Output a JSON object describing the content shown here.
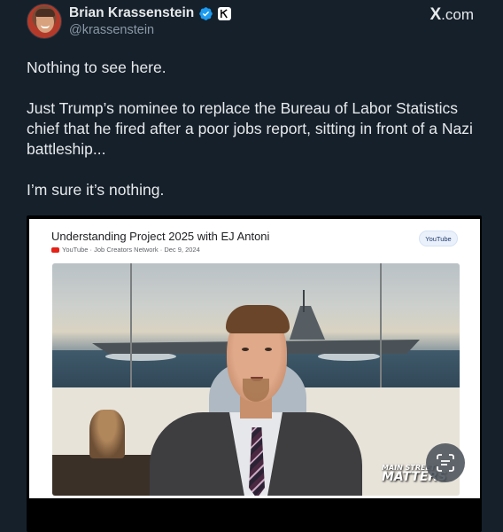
{
  "author": {
    "display_name": "Brian Krassenstein",
    "handle": "@krassenstein",
    "avatar_icon": "avatar-photo",
    "verified_icon": "verified-badge-icon",
    "affiliation_icon": "k-affiliate-icon"
  },
  "site": {
    "x": "X",
    "rest": ".com"
  },
  "tweet": {
    "paragraphs": [
      "Nothing to see here.",
      "Just Trump’s nominee to replace the Bureau of Labor Statistics chief that he fired after a poor jobs report, sitting in front of a Nazi battleship...",
      "I’m sure it’s nothing."
    ]
  },
  "media": {
    "video_title": "Understanding Project 2025 with EJ Antoni",
    "video_meta": "YouTube · Job Creators Network · Dec 9, 2024",
    "badge": "YouTube",
    "watermark_line1": "MAIN STREET",
    "watermark_line2": "MATTERS",
    "lens_icon": "visual-search-icon"
  },
  "colors": {
    "background": "#15202b",
    "text": "#e7e9ea",
    "muted": "#8b98a5",
    "verified": "#1d9bf0"
  }
}
